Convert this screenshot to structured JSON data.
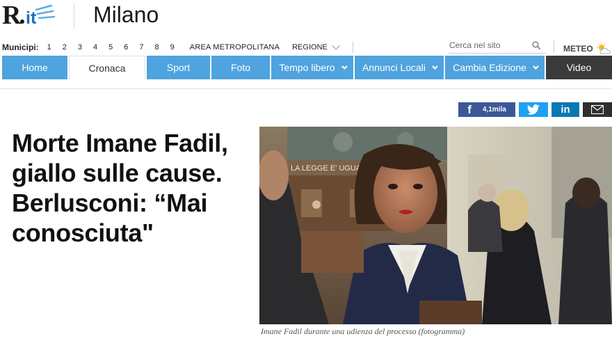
{
  "header": {
    "logo_text": "R.it",
    "city": "Milano"
  },
  "municipi": {
    "label": "Municipi:",
    "numbers": [
      "1",
      "2",
      "3",
      "4",
      "5",
      "6",
      "7",
      "8",
      "9"
    ],
    "area": "AREA METROPOLITANA",
    "region": "REGIONE"
  },
  "search": {
    "placeholder": "Cerca nel sito"
  },
  "meteo": {
    "label": "METEO"
  },
  "nav": {
    "items": [
      {
        "label": "Home"
      },
      {
        "label": "Cronaca"
      },
      {
        "label": "Sport"
      },
      {
        "label": "Foto"
      },
      {
        "label": "Tempo libero"
      },
      {
        "label": "Annunci Locali"
      },
      {
        "label": "Cambia Edizione"
      },
      {
        "label": "Video"
      }
    ]
  },
  "share": {
    "facebook_count": "4,1mila",
    "linkedin_label": "in"
  },
  "article": {
    "headline": "Morte Imane Fadil, giallo sulle cause. Berlusconi: “Mai conosciuta\"",
    "photo_wall_text": "LA LEGGE E' UGUALE",
    "caption": "Imane Fadil durante una udienza del processo (fotogramma)"
  },
  "colors": {
    "nav_blue": "#4fa3de",
    "facebook": "#3b5998",
    "twitter": "#1da1f2",
    "linkedin": "#0b77b5",
    "mail": "#2e2e2e"
  }
}
